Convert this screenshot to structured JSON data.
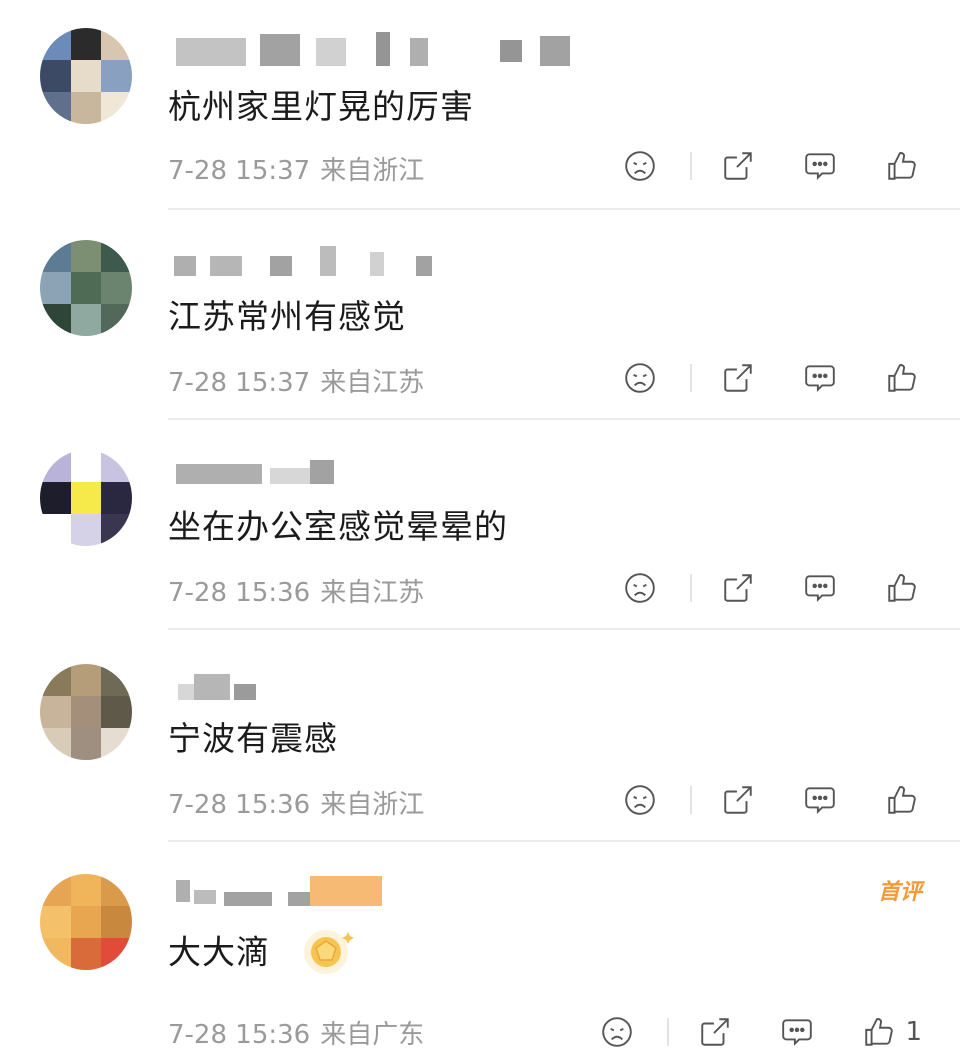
{
  "comments": [
    {
      "text": "杭州家里灯晃的厉害",
      "date": "7-28 15:37",
      "location": "来自浙江",
      "avatar_colors": [
        "#6d8bb8",
        "#2b2b2b",
        "#d9c6b0",
        "#3c4a66",
        "#e7dcc9",
        "#8aa0c0",
        "#5f6f8c",
        "#c9b79d",
        "#f0e7d6"
      ]
    },
    {
      "text": "江苏常州有感觉",
      "date": "7-28 15:37",
      "location": "来自江苏",
      "avatar_colors": [
        "#5d7b93",
        "#7c8f72",
        "#3e5a4c",
        "#8ca3b5",
        "#4f6b55",
        "#6b8470",
        "#2f4538",
        "#90a9a0",
        "#51685b"
      ]
    },
    {
      "text": "坐在办公室感觉晕晕的",
      "date": "7-28 15:36",
      "location": "来自江苏",
      "avatar_colors": [
        "#b9b2d9",
        "#ffffff",
        "#c7c3e0",
        "#1d1d2b",
        "#f5ea4a",
        "#2a2840",
        "#ffffff",
        "#d5d1e6",
        "#3a3650"
      ]
    },
    {
      "text": "宁波有震感",
      "date": "7-28 15:36",
      "location": "来自浙江",
      "avatar_colors": [
        "#8a7a5c",
        "#b59d7a",
        "#6f6a55",
        "#c8b49a",
        "#a38f7a",
        "#5e5948",
        "#d8cbb8",
        "#9e8f80",
        "#e5ddd2"
      ]
    },
    {
      "text": "大大滴",
      "date": "7-28 15:36",
      "location": "来自广东",
      "badge": "首评",
      "like_count": "1",
      "avatar_colors": [
        "#e6a552",
        "#f0b45a",
        "#d99a4c",
        "#f5c06a",
        "#e8a650",
        "#c8893f",
        "#f2b860",
        "#d96b3a",
        "#e24a3a"
      ]
    }
  ],
  "icons": {
    "dislike": "sad-face-icon",
    "share": "share-icon",
    "comment": "comment-bubble-icon",
    "like": "thumbs-up-icon",
    "medal": "medal-icon"
  },
  "colors": {
    "text": "#1b1b1b",
    "meta": "#9a9a9a",
    "icon": "#555555",
    "badge": "#f39a3a",
    "divider": "#ededed"
  }
}
